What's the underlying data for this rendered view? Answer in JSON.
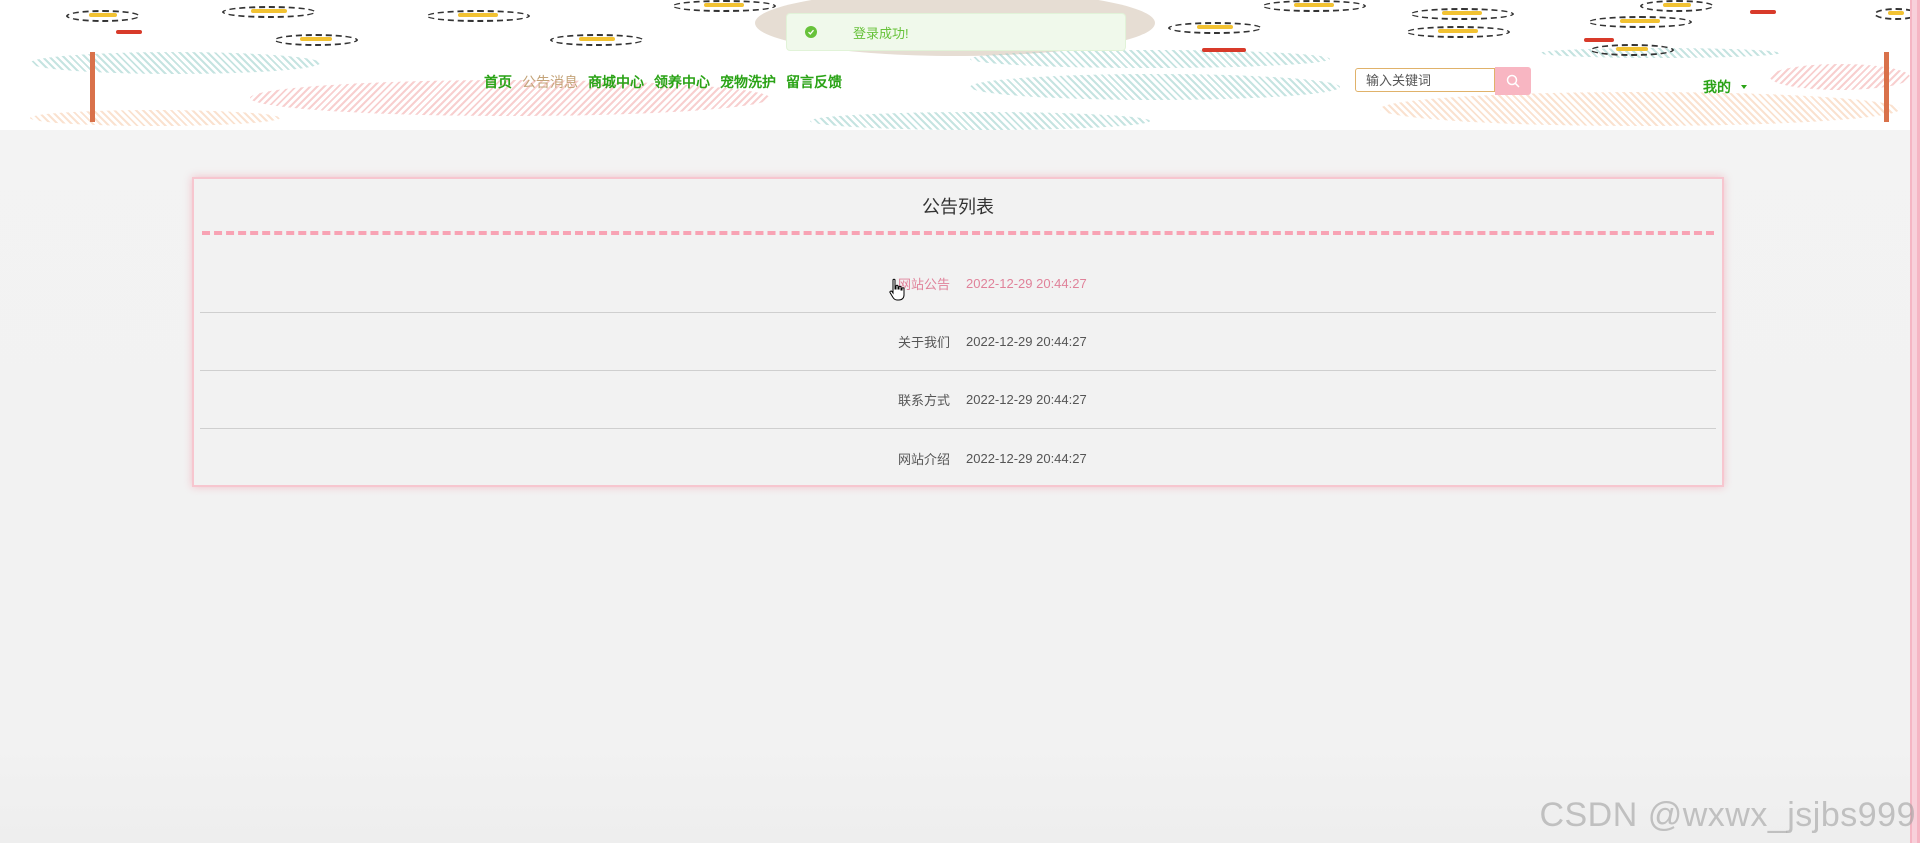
{
  "toast": {
    "message": "登录成功!",
    "icon": "check-circle-icon",
    "color": "#67c23a"
  },
  "nav": {
    "items": [
      {
        "label": "首页",
        "active": false
      },
      {
        "label": "公告消息",
        "active": true
      },
      {
        "label": "商城中心",
        "active": false
      },
      {
        "label": "领养中心",
        "active": false
      },
      {
        "label": "宠物洗护",
        "active": false
      },
      {
        "label": "留言反馈",
        "active": false
      }
    ],
    "color": "#2aa316",
    "active_color": "#c4a47a"
  },
  "search": {
    "placeholder": "输入关键词",
    "value": "",
    "icon": "search-icon",
    "button_color": "#f8b6c2"
  },
  "user_menu": {
    "label": "我的",
    "icon": "caret-down-icon"
  },
  "panel": {
    "title": "公告列表",
    "accent_color": "#f8a3b4",
    "notices": [
      {
        "title": "网站公告",
        "time": "2022-12-29 20:44:27"
      },
      {
        "title": "关于我们",
        "time": "2022-12-29 20:44:27"
      },
      {
        "title": "联系方式",
        "time": "2022-12-29 20:44:27"
      },
      {
        "title": "网站介绍",
        "time": "2022-12-29 20:44:27"
      }
    ],
    "hover_color": "#e0829a"
  },
  "watermark": "CSDN @wxwx_jsjbs999"
}
